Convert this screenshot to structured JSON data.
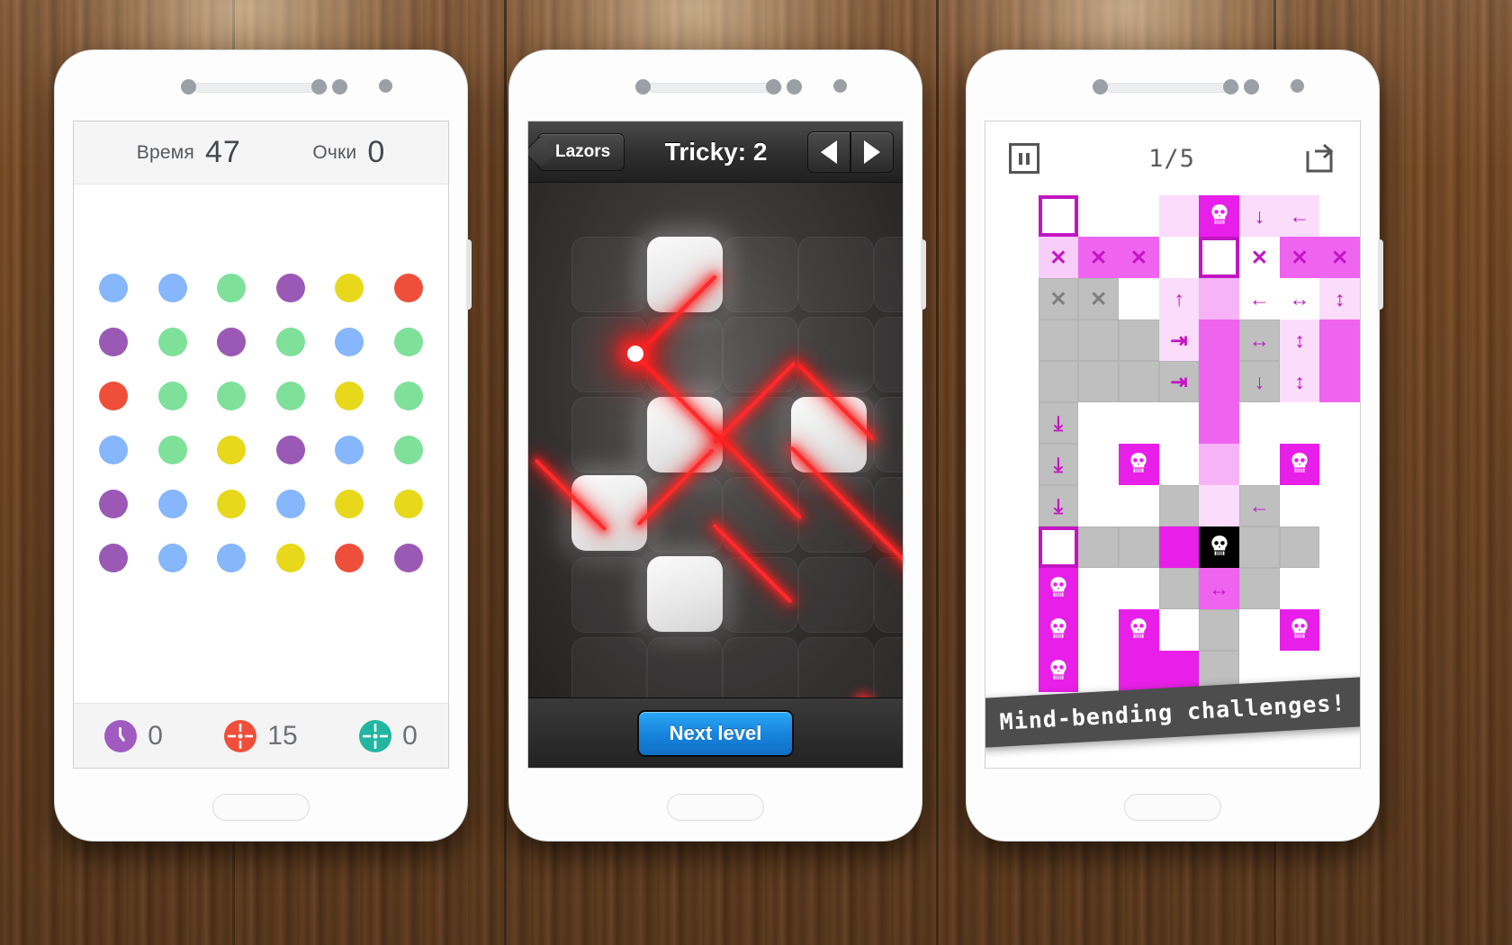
{
  "background": {
    "material": "wood-planks",
    "color": "#6d4524"
  },
  "phone1": {
    "name": "dots-game",
    "header": {
      "time_label": "Время",
      "time_value": "47",
      "score_label": "Очки",
      "score_value": "0"
    },
    "board": {
      "colors": {
        "blue": "#86b6fb",
        "green": "#7fe09a",
        "purple": "#9b59b6",
        "yellow": "#e8d81b",
        "red": "#ef4f3a"
      },
      "rows": [
        [
          "blue",
          "blue",
          "green",
          "purple",
          "yellow",
          "red"
        ],
        [
          "purple",
          "green",
          "purple",
          "green",
          "blue",
          "green"
        ],
        [
          "red",
          "green",
          "green",
          "green",
          "yellow",
          "green"
        ],
        [
          "blue",
          "green",
          "yellow",
          "purple",
          "blue",
          "green"
        ],
        [
          "purple",
          "blue",
          "yellow",
          "blue",
          "yellow",
          "yellow"
        ],
        [
          "purple",
          "blue",
          "blue",
          "yellow",
          "red",
          "purple"
        ]
      ]
    },
    "footer": [
      {
        "icon": "clock-icon",
        "color": "#a05bc0",
        "value": "0"
      },
      {
        "icon": "arrows-in-icon",
        "color": "#ef4f3a",
        "value": "15"
      },
      {
        "icon": "arrows-out-icon",
        "color": "#22b5a0",
        "value": "0"
      }
    ]
  },
  "phone2": {
    "name": "lazors-game",
    "header": {
      "back_label": "Lazors",
      "title": "Tricky: 2",
      "prev_icon": "triangle-left-icon",
      "next_icon": "triangle-right-icon"
    },
    "footer": {
      "next_level_label": "Next level"
    },
    "board": {
      "background": "dark-stone",
      "laser_color": "#ff2a2a",
      "blocks": [
        {
          "col": 1,
          "row": 0
        },
        {
          "col": 1,
          "row": 2
        },
        {
          "col": 0,
          "row": 3
        },
        {
          "col": 3,
          "row": 2
        },
        {
          "col": 1,
          "row": 4
        }
      ]
    }
  },
  "phone3": {
    "name": "puzzle-game",
    "header": {
      "pause_icon": "pause-icon",
      "counter": "1/5",
      "restart_icon": "restart-icon"
    },
    "banner_text": "Mind-bending challenges!",
    "colors": {
      "magenta": "#e81fe8",
      "magenta_light": "#ef64ef",
      "pink": "#f6b4f6",
      "pink_pale": "#fbdcfb",
      "gray": "#bfbfbf",
      "black": "#000000",
      "glyph": "#c315c3"
    },
    "grid": [
      [
        {
          "bg": "empty"
        },
        {
          "bg": "sel"
        },
        {
          "bg": "white"
        },
        {
          "bg": "white"
        },
        {
          "bg": "pink2"
        },
        {
          "bg": "mag",
          "g": "skull"
        },
        {
          "bg": "pink2",
          "g": "↓"
        },
        {
          "bg": "pink2",
          "g": "←"
        },
        {
          "bg": "empty"
        }
      ],
      [
        {
          "bg": "empty"
        },
        {
          "bg": "pinkx",
          "g": "✕"
        },
        {
          "bg": "mag2",
          "g": "✕"
        },
        {
          "bg": "mag2",
          "g": "✕"
        },
        {
          "bg": "white"
        },
        {
          "bg": "sel"
        },
        {
          "bg": "white",
          "g": "✕"
        },
        {
          "bg": "mag2",
          "g": "✕"
        },
        {
          "bg": "mag2",
          "g": "✕"
        }
      ],
      [
        {
          "bg": "empty"
        },
        {
          "bg": "gray",
          "g": "✕",
          "gray": true
        },
        {
          "bg": "gray",
          "g": "✕",
          "gray": true
        },
        {
          "bg": "white"
        },
        {
          "bg": "pink2",
          "g": "↑"
        },
        {
          "bg": "pink"
        },
        {
          "bg": "white",
          "g": "←"
        },
        {
          "bg": "white",
          "g": "↔"
        },
        {
          "bg": "pink2",
          "g": "↕"
        }
      ],
      [
        {
          "bg": "empty"
        },
        {
          "bg": "gray"
        },
        {
          "bg": "gray"
        },
        {
          "bg": "gray"
        },
        {
          "bg": "pink2",
          "g": "⇥"
        },
        {
          "bg": "mag2"
        },
        {
          "bg": "gray",
          "g": "↔"
        },
        {
          "bg": "pink2",
          "g": "↕"
        },
        {
          "bg": "mag2"
        }
      ],
      [
        {
          "bg": "empty"
        },
        {
          "bg": "gray"
        },
        {
          "bg": "gray"
        },
        {
          "bg": "gray"
        },
        {
          "bg": "gray",
          "g": "⇥"
        },
        {
          "bg": "mag2"
        },
        {
          "bg": "gray",
          "g": "↓"
        },
        {
          "bg": "pink2",
          "g": "↕"
        },
        {
          "bg": "mag2"
        }
      ],
      [
        {
          "bg": "empty"
        },
        {
          "bg": "gray",
          "g": "⤓"
        },
        {
          "bg": "white"
        },
        {
          "bg": "white"
        },
        {
          "bg": "white"
        },
        {
          "bg": "mag2"
        },
        {
          "bg": "white"
        },
        {
          "bg": "white"
        },
        {
          "bg": "empty"
        }
      ],
      [
        {
          "bg": "empty"
        },
        {
          "bg": "gray",
          "g": "⤓"
        },
        {
          "bg": "white"
        },
        {
          "bg": "mag",
          "g": "skull"
        },
        {
          "bg": "white"
        },
        {
          "bg": "pink"
        },
        {
          "bg": "white"
        },
        {
          "bg": "mag",
          "g": "skull"
        },
        {
          "bg": "empty"
        }
      ],
      [
        {
          "bg": "empty"
        },
        {
          "bg": "gray",
          "g": "⤓"
        },
        {
          "bg": "white"
        },
        {
          "bg": "white"
        },
        {
          "bg": "gray"
        },
        {
          "bg": "pink2"
        },
        {
          "bg": "gray",
          "g": "←"
        },
        {
          "bg": "white"
        },
        {
          "bg": "empty"
        }
      ],
      [
        {
          "bg": "empty"
        },
        {
          "bg": "sel"
        },
        {
          "bg": "gray"
        },
        {
          "bg": "gray"
        },
        {
          "bg": "mag"
        },
        {
          "bg": "black",
          "g": "skull"
        },
        {
          "bg": "gray"
        },
        {
          "bg": "gray"
        },
        {
          "bg": "empty"
        }
      ],
      [
        {
          "bg": "empty"
        },
        {
          "bg": "mag",
          "g": "skull"
        },
        {
          "bg": "white"
        },
        {
          "bg": "white"
        },
        {
          "bg": "gray"
        },
        {
          "bg": "mag2",
          "g": "↔"
        },
        {
          "bg": "gray"
        },
        {
          "bg": "white"
        },
        {
          "bg": "empty"
        }
      ],
      [
        {
          "bg": "empty"
        },
        {
          "bg": "mag",
          "g": "skull"
        },
        {
          "bg": "white"
        },
        {
          "bg": "mag",
          "g": "skull"
        },
        {
          "bg": "white"
        },
        {
          "bg": "gray"
        },
        {
          "bg": "white"
        },
        {
          "bg": "mag",
          "g": "skull"
        },
        {
          "bg": "empty"
        }
      ],
      [
        {
          "bg": "empty"
        },
        {
          "bg": "mag",
          "g": "skull"
        },
        {
          "bg": "white"
        },
        {
          "bg": "mag"
        },
        {
          "bg": "mag"
        },
        {
          "bg": "gray"
        },
        {
          "bg": "white"
        },
        {
          "bg": "white"
        },
        {
          "bg": "empty"
        }
      ]
    ]
  }
}
